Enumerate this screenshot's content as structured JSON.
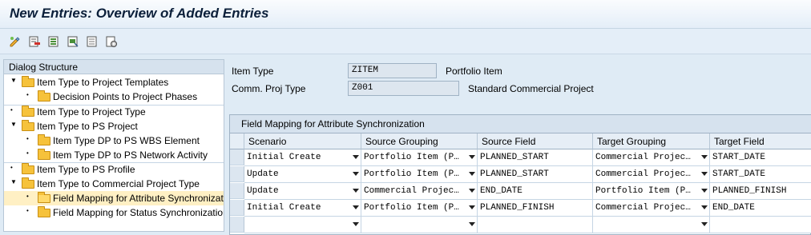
{
  "window": {
    "title": "New Entries: Overview of Added Entries"
  },
  "toolbar": {
    "icons": [
      "display-change-icon",
      "delete-icon",
      "select-all-icon",
      "select-block-icon",
      "deselect-all-icon",
      "configure-icon"
    ]
  },
  "dialog_structure": {
    "heading": "Dialog Structure",
    "items": [
      {
        "label": "Item Type to Project Templates",
        "level": 1,
        "expander": "▼"
      },
      {
        "label": "Decision Points to Project Phases",
        "level": 2,
        "expander": "•"
      },
      {
        "label": "Item Type to Project Type",
        "level": 1,
        "expander": "•"
      },
      {
        "label": "Item Type to PS Project",
        "level": 1,
        "expander": "▼"
      },
      {
        "label": "Item Type DP to PS WBS Element",
        "level": 2,
        "expander": "•"
      },
      {
        "label": "Item Type DP to PS Network Activity",
        "level": 2,
        "expander": "•"
      },
      {
        "label": "Item Type to PS Profile",
        "level": 1,
        "expander": "•"
      },
      {
        "label": "Item Type to Commercial Project Type",
        "level": 1,
        "expander": "▼"
      },
      {
        "label": "Field Mapping for Attribute Synchronization",
        "level": 2,
        "expander": "•",
        "selected": true
      },
      {
        "label": "Field Mapping for Status Synchronization",
        "level": 2,
        "expander": "•"
      }
    ]
  },
  "header": {
    "item_type": {
      "label": "Item Type",
      "value": "ZITEM",
      "description": "Portfolio Item"
    },
    "comm_proj_type": {
      "label": "Comm. Proj Type",
      "value": "Z001",
      "description": "Standard Commercial Project"
    }
  },
  "table": {
    "title": "Field Mapping for Attribute Synchronization",
    "columns": [
      "Scenario",
      "Source Grouping",
      "Source Field",
      "Target Grouping",
      "Target Field"
    ],
    "rows": [
      [
        "Initial Create",
        "Portfolio Item (P…",
        "PLANNED_START",
        "Commercial Projec…",
        "START_DATE"
      ],
      [
        "Update",
        "Portfolio Item (P…",
        "PLANNED_START",
        "Commercial Projec…",
        "START_DATE"
      ],
      [
        "Update",
        "Commercial Projec…",
        "END_DATE",
        "Portfolio Item (P…",
        "PLANNED_FINISH"
      ],
      [
        "Initial Create",
        "Portfolio Item (P…",
        "PLANNED_FINISH",
        "Commercial Projec…",
        "END_DATE"
      ],
      [
        "",
        "",
        "",
        "",
        ""
      ]
    ]
  },
  "colors": {
    "background": "#dfebf5",
    "selected_row": "#fff0c4",
    "folder": "#f6c23b"
  }
}
